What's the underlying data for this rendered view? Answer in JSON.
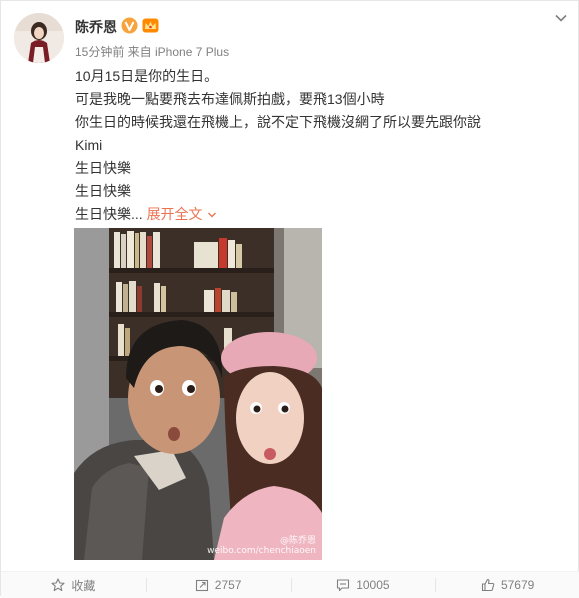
{
  "post": {
    "author": "陈乔恩",
    "meta": "15分钟前 来自 iPhone 7 Plus",
    "lines": [
      "10月15日是你的生日。",
      "可是我晚一點要飛去布達佩斯拍戲，要飛13個小時",
      "你生日的時候我還在飛機上，說不定下飛機沒網了所以要先跟你說",
      "Kimi",
      "生日快樂",
      "生日快樂",
      "生日快樂..."
    ],
    "expand_label": "展开全文",
    "photo_watermark_1": "@陈乔恩",
    "photo_watermark_2": "weibo.com/chenchiaoen"
  },
  "footer": {
    "collect": "收藏",
    "repost": "2757",
    "comment": "10005",
    "like": "57679"
  },
  "colors": {
    "accent": "#eb7350",
    "text": "#333333",
    "meta": "#808080",
    "vip_orange": "#f7a23b"
  },
  "icons": {
    "verified": "v-badge-icon",
    "crown": "crown-icon",
    "menu": "chevron-down-icon",
    "collect": "star-icon",
    "repost": "repost-icon",
    "comment": "comment-icon",
    "like": "thumbs-up-icon"
  }
}
